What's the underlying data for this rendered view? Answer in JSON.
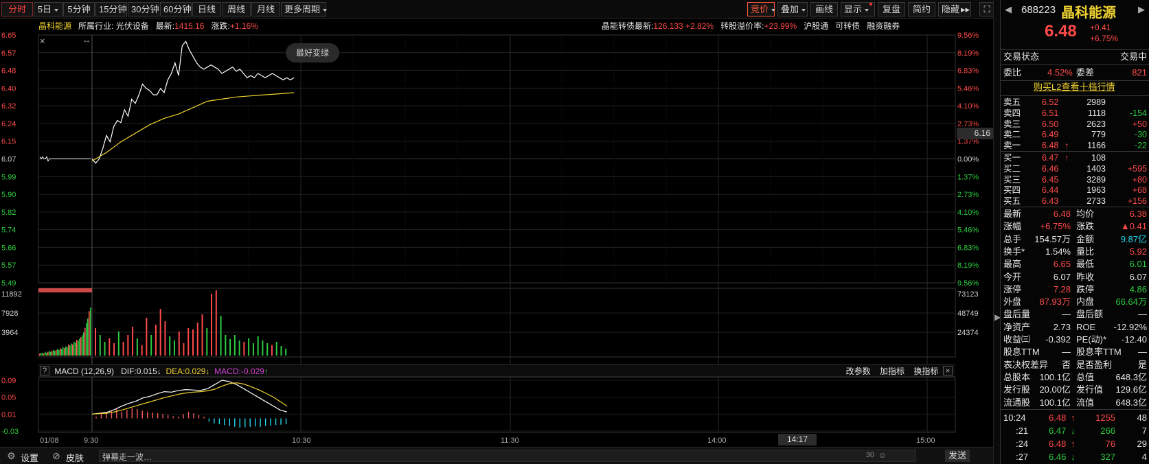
{
  "toolbar": {
    "left_items": [
      {
        "label": "分时",
        "active": true
      },
      {
        "label": "5日",
        "dropdown": true
      },
      {
        "label": "5分钟"
      },
      {
        "label": "15分钟"
      },
      {
        "label": "30分钟"
      },
      {
        "label": "60分钟"
      },
      {
        "label": "日线"
      },
      {
        "label": "周线"
      },
      {
        "label": "月线"
      },
      {
        "label": "更多周期",
        "dropdown": true
      }
    ],
    "right_items": [
      {
        "label": "竞价",
        "dropdown": true,
        "highlight": true
      },
      {
        "label": "叠加",
        "dropdown": true
      },
      {
        "label": "画线"
      },
      {
        "label": "显示",
        "dropdown": true,
        "dot": true
      },
      {
        "label": "复盘"
      },
      {
        "label": "简约"
      },
      {
        "label": "隐藏"
      }
    ]
  },
  "info": {
    "name": "晶科能源",
    "industry_label": "所属行业:",
    "industry": "光伏设备",
    "latest_label": "最新:",
    "latest": "1415.16",
    "change_label": "涨跌:",
    "change": "+1.16%",
    "bond_label": "晶能转债最新:",
    "bond_price": "126.133",
    "bond_change": "+2.82%",
    "premium_label": "转股溢价率:",
    "premium": "+23.99%",
    "links": [
      "沪股通",
      "可转债",
      "融资融券"
    ]
  },
  "chart_data": {
    "type": "line",
    "title": "",
    "price_axis": {
      "ticks": [
        "6.65",
        "6.57",
        "6.48",
        "6.40",
        "6.32",
        "6.24",
        "6.15",
        "6.07",
        "5.99",
        "5.90",
        "5.82",
        "5.74",
        "5.66",
        "5.57",
        "5.49"
      ],
      "pct_ticks": [
        "9.56%",
        "8.19%",
        "6.83%",
        "5.46%",
        "4.10%",
        "2.73%",
        "1.37%",
        "0.00%",
        "1.37%",
        "2.73%",
        "4.10%",
        "5.46%",
        "6.83%",
        "8.19%",
        "9.56%"
      ],
      "ylim": [
        5.49,
        6.65
      ],
      "prev_close": 6.07,
      "cursor_value": "6.16"
    },
    "time_axis": {
      "labels": [
        "01/08",
        "9:30",
        "10:30",
        "11:30",
        "14:00",
        "15:00"
      ],
      "cursor_time": "14:17"
    },
    "tooltip": "最好变绿",
    "series": [
      {
        "name": "price",
        "color": "#ffffff",
        "x": [
          0,
          1,
          2,
          3,
          4,
          5,
          6,
          7,
          8,
          9,
          10,
          11,
          12,
          13,
          14,
          15,
          16,
          17,
          18,
          19,
          20,
          21,
          22,
          23,
          24,
          25,
          26,
          27,
          28,
          29,
          30,
          31,
          32,
          33,
          34,
          35,
          36,
          37,
          38,
          39,
          40,
          41,
          42,
          43,
          44,
          45,
          46,
          47,
          48,
          49,
          50,
          51,
          52,
          53,
          54,
          55,
          56
        ],
        "values": [
          6.07,
          6.05,
          6.07,
          6.12,
          6.18,
          6.15,
          6.22,
          6.25,
          6.24,
          6.3,
          6.27,
          6.35,
          6.33,
          6.37,
          6.42,
          6.4,
          6.39,
          6.37,
          6.37,
          6.4,
          6.38,
          6.44,
          6.47,
          6.52,
          6.46,
          6.6,
          6.62,
          6.58,
          6.55,
          6.52,
          6.5,
          6.49,
          6.5,
          6.51,
          6.5,
          6.49,
          6.47,
          6.48,
          6.49,
          6.5,
          6.48,
          6.49,
          6.47,
          6.45,
          6.46,
          6.45,
          6.47,
          6.46,
          6.45,
          6.46,
          6.47,
          6.46,
          6.45,
          6.44,
          6.45,
          6.44,
          6.45
        ]
      },
      {
        "name": "avg",
        "color": "#f0d230",
        "x": [
          0,
          4,
          8,
          12,
          16,
          20,
          24,
          28,
          32,
          36,
          40,
          44,
          48,
          52,
          56
        ],
        "values": [
          6.06,
          6.1,
          6.15,
          6.19,
          6.23,
          6.26,
          6.28,
          6.31,
          6.34,
          6.35,
          6.36,
          6.365,
          6.37,
          6.375,
          6.38
        ]
      }
    ],
    "pre_market": {
      "values": [
        6.08,
        6.07,
        6.08,
        6.07,
        6.07,
        6.08,
        6.06,
        6.07
      ]
    },
    "volume": {
      "ticks_left": [
        "11892",
        "7928",
        "3964"
      ],
      "ticks_right": [
        "73123",
        "48749",
        "24374"
      ],
      "premarket_values": [
        2,
        3,
        3,
        2,
        4,
        3,
        4,
        5,
        4,
        5,
        6,
        5,
        6,
        7,
        6,
        8,
        7,
        9,
        8,
        10,
        9,
        12,
        11,
        13,
        12,
        15,
        14,
        17,
        16,
        18,
        20,
        22,
        25,
        30,
        35,
        40,
        48,
        52
      ],
      "premarket_colors": "mixed",
      "bars": [
        {
          "v": 40,
          "c": "r"
        },
        {
          "v": 30,
          "c": "g"
        },
        {
          "v": 20,
          "c": "g"
        },
        {
          "v": 25,
          "c": "r"
        },
        {
          "v": 18,
          "c": "r"
        },
        {
          "v": 35,
          "c": "g"
        },
        {
          "v": 20,
          "c": "r"
        },
        {
          "v": 30,
          "c": "r"
        },
        {
          "v": 42,
          "c": "r"
        },
        {
          "v": 25,
          "c": "g"
        },
        {
          "v": 15,
          "c": "r"
        },
        {
          "v": 55,
          "c": "r"
        },
        {
          "v": 30,
          "c": "g"
        },
        {
          "v": 45,
          "c": "r"
        },
        {
          "v": 68,
          "c": "r"
        },
        {
          "v": 50,
          "c": "r"
        },
        {
          "v": 28,
          "c": "g"
        },
        {
          "v": 22,
          "c": "g"
        },
        {
          "v": 35,
          "c": "r"
        },
        {
          "v": 18,
          "c": "r"
        },
        {
          "v": 40,
          "c": "r"
        },
        {
          "v": 38,
          "c": "r"
        },
        {
          "v": 48,
          "c": "r"
        },
        {
          "v": 60,
          "c": "r"
        },
        {
          "v": 40,
          "c": "g"
        },
        {
          "v": 90,
          "c": "r"
        },
        {
          "v": 95,
          "c": "r"
        },
        {
          "v": 58,
          "c": "g"
        },
        {
          "v": 30,
          "c": "g"
        },
        {
          "v": 24,
          "c": "g"
        },
        {
          "v": 30,
          "c": "g"
        },
        {
          "v": 22,
          "c": "g"
        },
        {
          "v": 20,
          "c": "r"
        },
        {
          "v": 25,
          "c": "g"
        },
        {
          "v": 18,
          "c": "g"
        },
        {
          "v": 28,
          "c": "g"
        },
        {
          "v": 22,
          "c": "g"
        },
        {
          "v": 18,
          "c": "g"
        },
        {
          "v": 15,
          "c": "r"
        },
        {
          "v": 20,
          "c": "g"
        },
        {
          "v": 14,
          "c": "g"
        },
        {
          "v": 10,
          "c": "g"
        }
      ]
    },
    "macd": {
      "params": "MACD (12,26,9)",
      "dif": "DIF:0.015",
      "dea": "DEA:0.029",
      "macd": "MACD:-0.029",
      "ticks": [
        "0.09",
        "0.05",
        "0.01",
        "-0.03"
      ],
      "controls": [
        "改参数",
        "加指标",
        "换指标"
      ],
      "dif_values": [
        0.01,
        0.012,
        0.014,
        0.02,
        0.028,
        0.035,
        0.04,
        0.048,
        0.052,
        0.058,
        0.063,
        0.062,
        0.066,
        0.068,
        0.067,
        0.066,
        0.07,
        0.08,
        0.09,
        0.087,
        0.08,
        0.07,
        0.06,
        0.05,
        0.04,
        0.03,
        0.02,
        0.015
      ],
      "dea_values": [
        0.01,
        0.011,
        0.012,
        0.015,
        0.019,
        0.024,
        0.029,
        0.034,
        0.039,
        0.044,
        0.049,
        0.053,
        0.057,
        0.06,
        0.062,
        0.063,
        0.065,
        0.069,
        0.076,
        0.082,
        0.084,
        0.081,
        0.075,
        0.068,
        0.06,
        0.051,
        0.04,
        0.029
      ],
      "hist": [
        0.004,
        0.01,
        0.014,
        0.018,
        0.022,
        0.016,
        0.02,
        0.024,
        0.022,
        0.018,
        0.016,
        0.014,
        0.012,
        0.01,
        0.008,
        0.005,
        0.004,
        0.01,
        0.016,
        0.012,
        0.008,
        0.004,
        -0.008,
        -0.012,
        -0.014,
        -0.016,
        -0.018,
        -0.02,
        -0.022,
        -0.021,
        -0.02,
        -0.019,
        -0.02,
        -0.018,
        -0.017,
        -0.016,
        -0.015,
        -0.014
      ]
    }
  },
  "bottom": {
    "settings": "设置",
    "skin": "皮肤",
    "danmu_placeholder": "弹幕走一波…",
    "count": "30",
    "send": "发送"
  },
  "right_panel": {
    "code": "688223",
    "name": "晶科能源",
    "price": "6.48",
    "change": "+0.41",
    "change_pct": "+6.75%",
    "trade_state_label": "交易状态",
    "trade_state": "交易中",
    "weibi_label": "委比",
    "weibi": "4.52%",
    "weicha_label": "委差",
    "weicha": "821",
    "l2_link": "购买L2查看十档行情",
    "asks": [
      {
        "label": "卖五",
        "price": "6.52",
        "vol": "2989",
        "chg": "",
        "arrow": ""
      },
      {
        "label": "卖四",
        "price": "6.51",
        "vol": "1118",
        "chg": "-154",
        "arrow": ""
      },
      {
        "label": "卖三",
        "price": "6.50",
        "vol": "2623",
        "chg": "+50",
        "arrow": ""
      },
      {
        "label": "卖二",
        "price": "6.49",
        "vol": "779",
        "chg": "-30",
        "arrow": ""
      },
      {
        "label": "卖一",
        "price": "6.48",
        "vol": "1166",
        "chg": "-22",
        "arrow": "up"
      }
    ],
    "bids": [
      {
        "label": "买一",
        "price": "6.47",
        "vol": "108",
        "chg": "",
        "arrow": "up"
      },
      {
        "label": "买二",
        "price": "6.46",
        "vol": "1403",
        "chg": "+595",
        "arrow": ""
      },
      {
        "label": "买三",
        "price": "6.45",
        "vol": "3289",
        "chg": "+80",
        "arrow": ""
      },
      {
        "label": "买四",
        "price": "6.44",
        "vol": "1963",
        "chg": "+68",
        "arrow": ""
      },
      {
        "label": "买五",
        "price": "6.43",
        "vol": "2733",
        "chg": "+156",
        "arrow": ""
      }
    ],
    "stats": [
      {
        "l1": "最新",
        "v1": "6.48",
        "c1": "red",
        "l2": "均价",
        "v2": "6.38",
        "c2": "red"
      },
      {
        "l1": "涨幅",
        "v1": "+6.75%",
        "c1": "red",
        "l2": "涨跌",
        "v2": "▲0.41",
        "c2": "red"
      },
      {
        "l1": "总手",
        "v1": "154.57万",
        "c1": "white",
        "l2": "金额",
        "v2": "9.87亿",
        "c2": "cyan"
      },
      {
        "l1": "换手*",
        "v1": "1.54%",
        "c1": "white",
        "l2": "量比",
        "v2": "5.92",
        "c2": "red"
      },
      {
        "l1": "最高",
        "v1": "6.65",
        "c1": "red",
        "l2": "最低",
        "v2": "6.01",
        "c2": "green"
      },
      {
        "l1": "今开",
        "v1": "6.07",
        "c1": "white",
        "l2": "昨收",
        "v2": "6.07",
        "c2": "white"
      },
      {
        "l1": "涨停",
        "v1": "7.28",
        "c1": "red",
        "l2": "跌停",
        "v2": "4.86",
        "c2": "green"
      },
      {
        "l1": "外盘",
        "v1": "87.93万",
        "c1": "red",
        "l2": "内盘",
        "v2": "66.64万",
        "c2": "green"
      },
      {
        "l1": "盘后量",
        "v1": "—",
        "c1": "white",
        "l2": "盘后额",
        "v2": "—",
        "c2": "white"
      },
      {
        "l1": "净资产",
        "v1": "2.73",
        "c1": "white",
        "l2": "ROE",
        "v2": "-12.92%",
        "c2": "white"
      },
      {
        "l1": "收益㈢",
        "v1": "-0.392",
        "c1": "white",
        "l2": "PE(动)*",
        "v2": "-12.40",
        "c2": "white"
      },
      {
        "l1": "股息TTM",
        "v1": "—",
        "c1": "white",
        "l2": "股息率TTM",
        "v2": "—",
        "c2": "white"
      },
      {
        "l1": "表决权差异",
        "v1": "否",
        "c1": "white",
        "l2": "是否盈利",
        "v2": "是",
        "c2": "white"
      },
      {
        "l1": "总股本",
        "v1": "100.1亿",
        "c1": "white",
        "l2": "总值",
        "v2": "648.3亿",
        "c2": "white"
      },
      {
        "l1": "发行股",
        "v1": "20.00亿",
        "c1": "white",
        "l2": "发行值",
        "v2": "129.6亿",
        "c2": "white"
      },
      {
        "l1": "流通股",
        "v1": "100.1亿",
        "c1": "white",
        "l2": "流值",
        "v2": "648.3亿",
        "c2": "white"
      }
    ],
    "ticks": [
      {
        "time": "10:24",
        "price": "6.48",
        "dir": "up",
        "vol": "1255",
        "n": "48"
      },
      {
        "time": ":21",
        "price": "6.47",
        "dir": "down",
        "vol": "266",
        "n": "7"
      },
      {
        "time": ":24",
        "price": "6.48",
        "dir": "up",
        "vol": "76",
        "n": "29"
      },
      {
        "time": ":27",
        "price": "6.46",
        "dir": "down",
        "vol": "327",
        "n": "4"
      }
    ]
  }
}
